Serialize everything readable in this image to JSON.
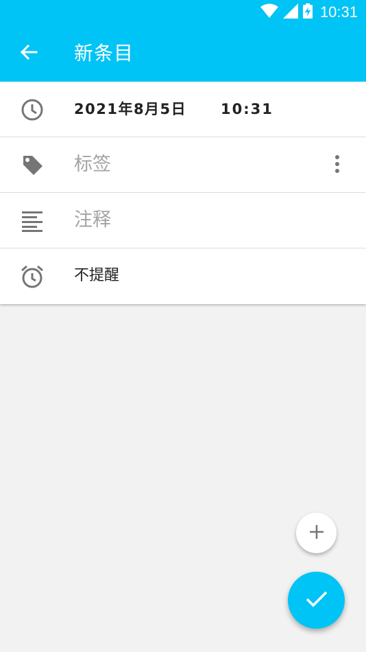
{
  "status_bar": {
    "time": "10:31",
    "icons": [
      "wifi-icon",
      "cellular-signal-icon",
      "battery-charging-icon"
    ]
  },
  "app_bar": {
    "back_icon": "arrow-back-icon",
    "title": "新条目"
  },
  "form": {
    "datetime": {
      "icon": "clock-icon",
      "date": "2021年8月5日",
      "time": "10:31"
    },
    "tags": {
      "icon": "tag-icon",
      "placeholder": "标签",
      "menu_icon": "more-vert-icon"
    },
    "notes": {
      "icon": "notes-icon",
      "placeholder": "注释"
    },
    "reminder": {
      "icon": "alarm-icon",
      "value": "不提醒"
    }
  },
  "fabs": {
    "add_icon": "plus-icon",
    "save_icon": "check-icon"
  },
  "colors": {
    "primary": "#00c4f5",
    "background": "#f2f2f2",
    "icon_gray": "#757575",
    "placeholder_gray": "#a3a3a3"
  }
}
